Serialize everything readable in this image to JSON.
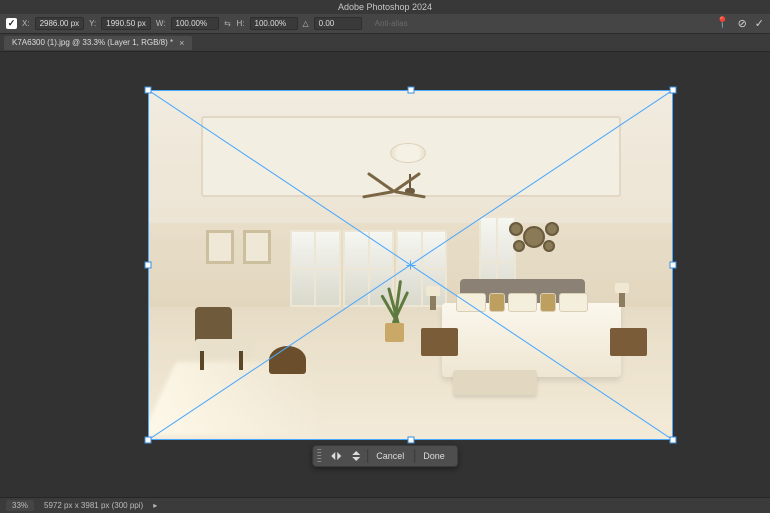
{
  "app": {
    "title": "Adobe Photoshop 2024"
  },
  "options": {
    "x_label": "X:",
    "x_value": "2986.00 px",
    "y_label": "Y:",
    "y_value": "1990.50 px",
    "w_label": "W:",
    "w_value": "100.00%",
    "h_label": "H:",
    "h_value": "100.00%",
    "angle_label": "△",
    "angle_value": "0.00",
    "antialias_label": "Anti-alias"
  },
  "document": {
    "tab_label": "K7A6300 (1).jpg @ 33.3% (Layer 1, RGB/8) *"
  },
  "confirm": {
    "cancel": "Cancel",
    "done": "Done"
  },
  "status": {
    "zoom": "33%",
    "docinfo": "5972 px x 3981 px (300 ppi)"
  }
}
